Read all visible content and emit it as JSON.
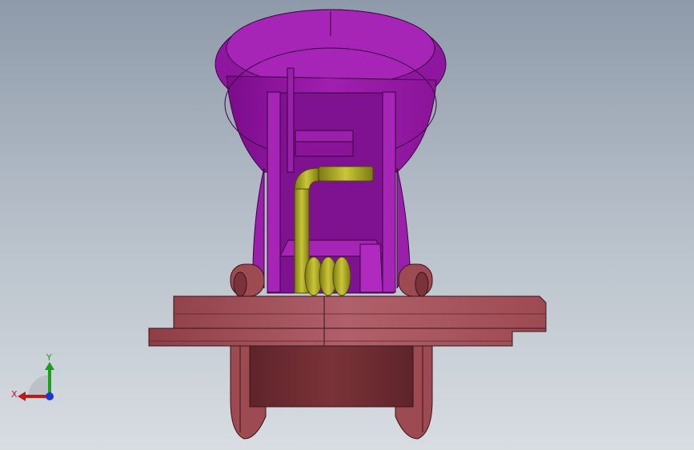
{
  "viewport": {
    "background_top": "#8e9aaa",
    "background_bottom": "#d8dde2"
  },
  "model": {
    "parts": [
      {
        "name": "housing",
        "color": "#a01fb0"
      },
      {
        "name": "spring",
        "color": "#a6a41e"
      },
      {
        "name": "base-plate",
        "color": "#a4545a"
      },
      {
        "name": "roller",
        "color": "#7a3338"
      }
    ]
  },
  "triad": {
    "x_label": "X",
    "y_label": "Y",
    "x_color": "#c01818",
    "y_color": "#18a018",
    "z_color": "#1838d0"
  }
}
